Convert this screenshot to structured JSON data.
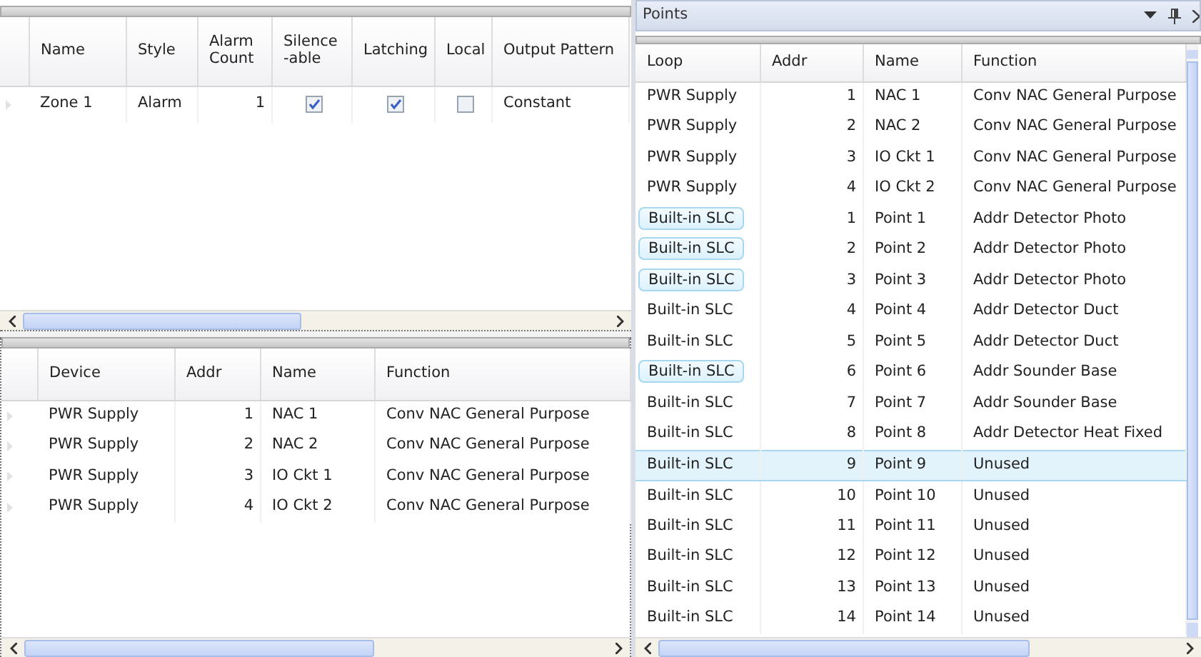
{
  "zones": {
    "columns": [
      "Name",
      "Style",
      "Alarm Count",
      "Silence\n-able",
      "Latching",
      "Local",
      "Output Pattern"
    ],
    "rows": [
      {
        "name": "Zone 1",
        "style": "Alarm",
        "alarm_count": "1",
        "silenceable": true,
        "latching": true,
        "local": false,
        "output_pattern": "Constant"
      }
    ]
  },
  "devices": {
    "columns": [
      "Device",
      "Addr",
      "Name",
      "Function"
    ],
    "rows": [
      {
        "device": "PWR Supply",
        "addr": "1",
        "name": "NAC 1",
        "function": "Conv NAC General Purpose"
      },
      {
        "device": "PWR Supply",
        "addr": "2",
        "name": "NAC 2",
        "function": "Conv NAC General Purpose"
      },
      {
        "device": "PWR Supply",
        "addr": "3",
        "name": "IO Ckt 1",
        "function": "Conv NAC General Purpose"
      },
      {
        "device": "PWR Supply",
        "addr": "4",
        "name": "IO Ckt 2",
        "function": "Conv NAC General Purpose"
      }
    ]
  },
  "points": {
    "title": "Points",
    "columns": [
      "Loop",
      "Addr",
      "Name",
      "Function"
    ],
    "rows": [
      {
        "loop": "PWR Supply",
        "addr": "1",
        "name": "NAC 1",
        "function": "Conv NAC General Purpose",
        "loop_highlighted": false,
        "selected": false
      },
      {
        "loop": "PWR Supply",
        "addr": "2",
        "name": "NAC 2",
        "function": "Conv NAC General Purpose",
        "loop_highlighted": false,
        "selected": false
      },
      {
        "loop": "PWR Supply",
        "addr": "3",
        "name": "IO Ckt 1",
        "function": "Conv NAC General Purpose",
        "loop_highlighted": false,
        "selected": false
      },
      {
        "loop": "PWR Supply",
        "addr": "4",
        "name": "IO Ckt 2",
        "function": "Conv NAC General Purpose",
        "loop_highlighted": false,
        "selected": false
      },
      {
        "loop": "Built-in SLC",
        "addr": "1",
        "name": "Point 1",
        "function": "Addr Detector Photo",
        "loop_highlighted": true,
        "selected": false
      },
      {
        "loop": "Built-in SLC",
        "addr": "2",
        "name": "Point 2",
        "function": "Addr Detector Photo",
        "loop_highlighted": true,
        "selected": false
      },
      {
        "loop": "Built-in SLC",
        "addr": "3",
        "name": "Point 3",
        "function": "Addr Detector Photo",
        "loop_highlighted": true,
        "selected": false
      },
      {
        "loop": "Built-in SLC",
        "addr": "4",
        "name": "Point 4",
        "function": "Addr Detector Duct",
        "loop_highlighted": false,
        "selected": false
      },
      {
        "loop": "Built-in SLC",
        "addr": "5",
        "name": "Point 5",
        "function": "Addr Detector Duct",
        "loop_highlighted": false,
        "selected": false
      },
      {
        "loop": "Built-in SLC",
        "addr": "6",
        "name": "Point 6",
        "function": "Addr Sounder Base",
        "loop_highlighted": true,
        "selected": false
      },
      {
        "loop": "Built-in SLC",
        "addr": "7",
        "name": "Point 7",
        "function": "Addr Sounder Base",
        "loop_highlighted": false,
        "selected": false
      },
      {
        "loop": "Built-in SLC",
        "addr": "8",
        "name": "Point 8",
        "function": "Addr Detector Heat Fixed",
        "loop_highlighted": false,
        "selected": false
      },
      {
        "loop": "Built-in SLC",
        "addr": "9",
        "name": "Point 9",
        "function": "Unused",
        "loop_highlighted": false,
        "selected": true
      },
      {
        "loop": "Built-in SLC",
        "addr": "10",
        "name": "Point 10",
        "function": "Unused",
        "loop_highlighted": false,
        "selected": false
      },
      {
        "loop": "Built-in SLC",
        "addr": "11",
        "name": "Point 11",
        "function": "Unused",
        "loop_highlighted": false,
        "selected": false
      },
      {
        "loop": "Built-in SLC",
        "addr": "12",
        "name": "Point 12",
        "function": "Unused",
        "loop_highlighted": false,
        "selected": false
      },
      {
        "loop": "Built-in SLC",
        "addr": "13",
        "name": "Point 13",
        "function": "Unused",
        "loop_highlighted": false,
        "selected": false
      },
      {
        "loop": "Built-in SLC",
        "addr": "14",
        "name": "Point 14",
        "function": "Unused",
        "loop_highlighted": false,
        "selected": false
      }
    ]
  }
}
